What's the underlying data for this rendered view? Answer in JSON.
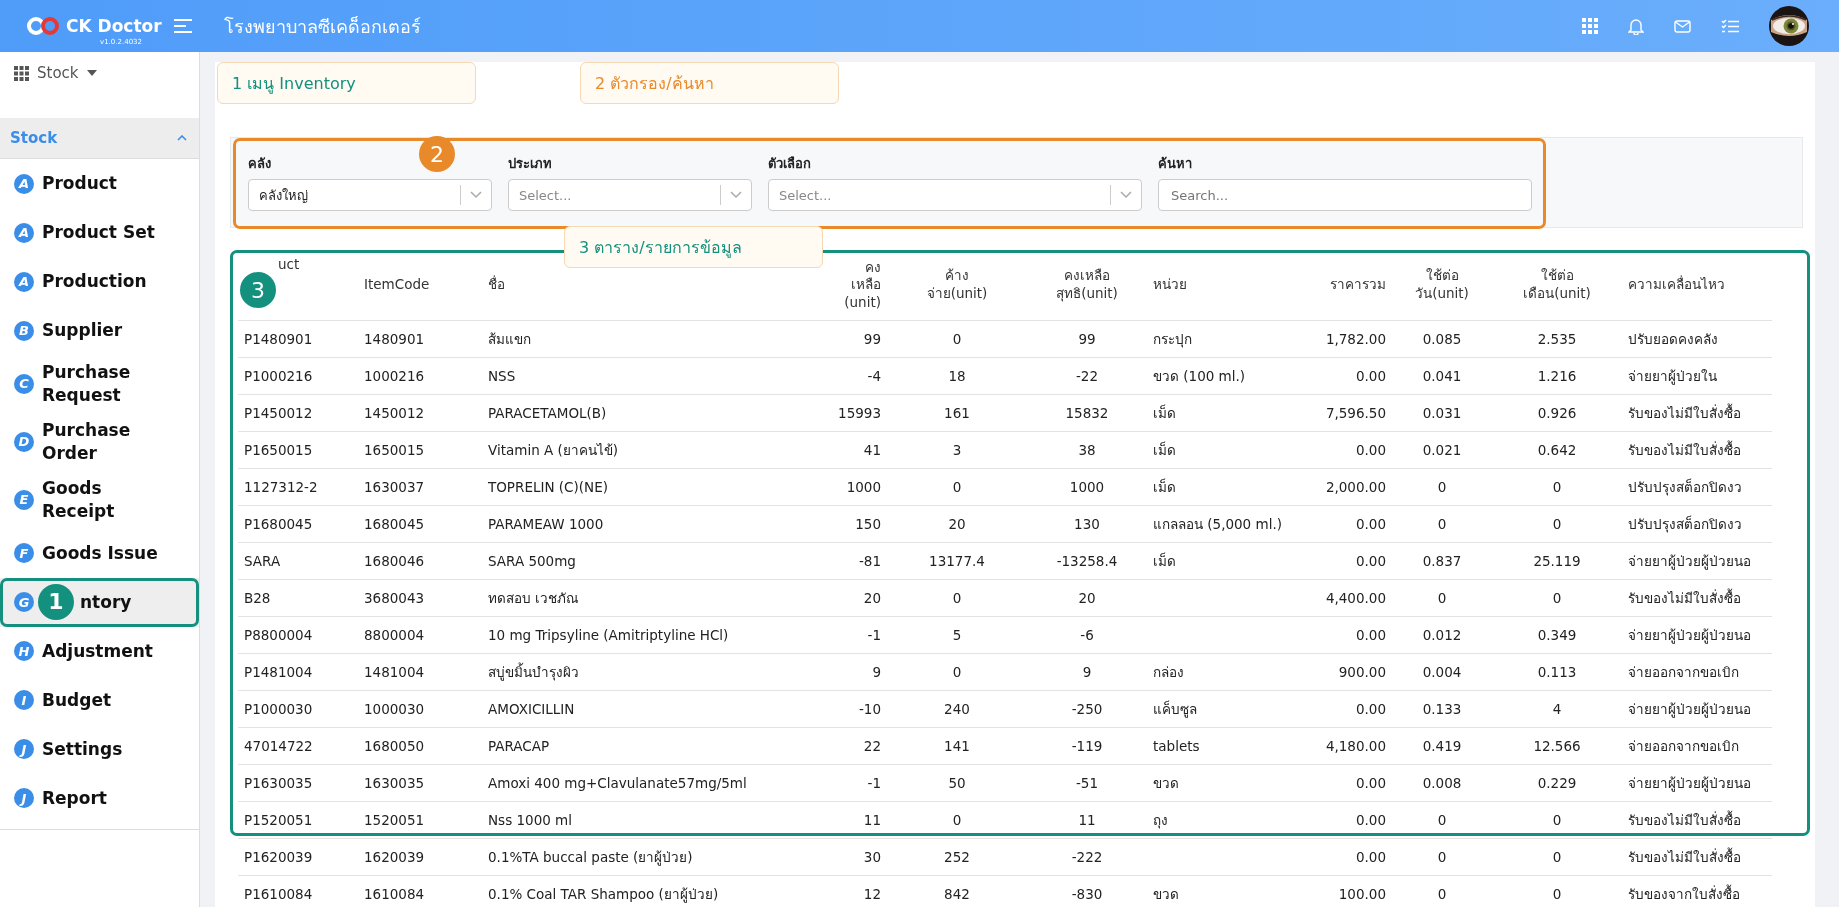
{
  "header": {
    "logo": "CK Doctor",
    "version": "v1.0.2.4032",
    "title": "โรงพยาบาลซีเคด็อกเตอร์"
  },
  "sidebar": {
    "module": "Stock",
    "section": {
      "label": "Stock",
      "expanded": true
    },
    "items": [
      {
        "letter": "A",
        "label": "Product",
        "selected": false
      },
      {
        "letter": "A",
        "label": "Product Set",
        "selected": false
      },
      {
        "letter": "A",
        "label": "Production",
        "selected": false
      },
      {
        "letter": "B",
        "label": "Supplier",
        "selected": false
      },
      {
        "letter": "C",
        "label": "Purchase Request",
        "selected": false
      },
      {
        "letter": "D",
        "label": "Purchase Order",
        "selected": false
      },
      {
        "letter": "E",
        "label": "Goods Receipt",
        "selected": false
      },
      {
        "letter": "F",
        "label": "Goods Issue",
        "selected": false
      },
      {
        "letter": "G",
        "label": "ntory",
        "selected": true,
        "marker": {
          "number": "1",
          "color": "#13907e"
        }
      },
      {
        "letter": "H",
        "label": "Adjustment",
        "selected": false
      },
      {
        "letter": "I",
        "label": "Budget",
        "selected": false
      },
      {
        "letter": "J",
        "label": "Settings",
        "selected": false
      },
      {
        "letter": "J",
        "label": "Report",
        "selected": false
      }
    ]
  },
  "callouts": [
    {
      "text": "1 เมนู Inventory",
      "color": "#13907e"
    },
    {
      "text": "2 ตัวกรอง/ค้นหา",
      "color": "#e8892a"
    },
    {
      "text": "3 ตาราง/รายการข้อมูล",
      "color": "#13907e"
    }
  ],
  "filters": {
    "marker": {
      "number": "2",
      "color": "#e8892a"
    },
    "fields": [
      {
        "kind": "select",
        "label": "คลัง",
        "value": "คลังใหญ่"
      },
      {
        "kind": "select",
        "label": "ประเภท",
        "placeholder": "Select..."
      },
      {
        "kind": "select",
        "label": "ตัวเลือก",
        "placeholder": "Select..."
      },
      {
        "kind": "search",
        "label": "ค้นหา",
        "placeholder": "Search..."
      }
    ]
  },
  "table": {
    "marker": {
      "number": "3",
      "color": "#13907e"
    },
    "columns": [
      "uct",
      "ItemCode",
      "ชื่อ",
      "คง\nเหลือ\n(unit)",
      "ค้าง\nจ่าย(unit)",
      "คงเหลือ\nสุทธิ(unit)",
      "หน่วย",
      "ราคารวม",
      "ใช้ต่อ\nวัน(unit)",
      "ใช้ต่อ\nเดือน(unit)",
      "ความเคลื่อนไหว"
    ],
    "rows": [
      {
        "product": "P1480901",
        "item_code": "1480901",
        "name": "ส้มแขก",
        "on_hand": "99",
        "pending": "0",
        "net": "99",
        "unit": "กระปุก",
        "total": "1,782.00",
        "per_day": "0.085",
        "per_month": "2.535",
        "movement": "ปรับยอดคงคลัง"
      },
      {
        "product": "P1000216",
        "item_code": "1000216",
        "name": "NSS",
        "on_hand": "-4",
        "pending": "18",
        "net": "-22",
        "unit": "ขวด (100 ml.)",
        "total": "0.00",
        "per_day": "0.041",
        "per_month": "1.216",
        "movement": "จ่ายยาผู้ป่วยใน"
      },
      {
        "product": "P1450012",
        "item_code": "1450012",
        "name": "PARACETAMOL(B)",
        "on_hand": "15993",
        "pending": "161",
        "net": "15832",
        "unit": "เม็ด",
        "total": "7,596.50",
        "per_day": "0.031",
        "per_month": "0.926",
        "movement": "รับของไม่มีใบสั่งซื้อ"
      },
      {
        "product": "P1650015",
        "item_code": "1650015",
        "name": "Vitamin A (ยาคนไข้)",
        "on_hand": "41",
        "pending": "3",
        "net": "38",
        "unit": "เม็ด",
        "total": "0.00",
        "per_day": "0.021",
        "per_month": "0.642",
        "movement": "รับของไม่มีใบสั่งซื้อ"
      },
      {
        "product": "1127312-2",
        "item_code": "1630037",
        "name": "TOPRELIN (C)(NE)",
        "on_hand": "1000",
        "pending": "0",
        "net": "1000",
        "unit": "เม็ด",
        "total": "2,000.00",
        "per_day": "0",
        "per_month": "0",
        "movement": "ปรับปรุงสต็อกปิดงว"
      },
      {
        "product": "P1680045",
        "item_code": "1680045",
        "name": "PARAMEAW 1000",
        "on_hand": "150",
        "pending": "20",
        "net": "130",
        "unit": "แกลลอน (5,000 ml.)",
        "total": "0.00",
        "per_day": "0",
        "per_month": "0",
        "movement": "ปรับปรุงสต็อกปิดงว"
      },
      {
        "product": "SARA",
        "item_code": "1680046",
        "name": "SARA 500mg",
        "on_hand": "-81",
        "pending": "13177.4",
        "net": "-13258.4",
        "unit": "เม็ด",
        "total": "0.00",
        "per_day": "0.837",
        "per_month": "25.119",
        "movement": "จ่ายยาผู้ป่วยผู้ป่วยนอ"
      },
      {
        "product": "B28",
        "item_code": "3680043",
        "name": "ทดสอบ เวชภัณ",
        "on_hand": "20",
        "pending": "0",
        "net": "20",
        "total": "4,400.00",
        "per_day": "0",
        "per_month": "0",
        "movement": "รับของไม่มีใบสั่งซื้อ"
      },
      {
        "product": "P8800004",
        "item_code": "8800004",
        "name": "10 mg Tripsyline (Amitriptyline HCl)",
        "on_hand": "-1",
        "pending": "5",
        "net": "-6",
        "total": "0.00",
        "per_day": "0.012",
        "per_month": "0.349",
        "movement": "จ่ายยาผู้ป่วยผู้ป่วยนอ"
      },
      {
        "product": "P1481004",
        "item_code": "1481004",
        "name": "สบู่ขมิ้นบำรุงผิว",
        "on_hand": "9",
        "pending": "0",
        "net": "9",
        "unit": "กล่อง",
        "total": "900.00",
        "per_day": "0.004",
        "per_month": "0.113",
        "movement": "จ่ายออกจากขอเบิก"
      },
      {
        "product": "P1000030",
        "item_code": "1000030",
        "name": "AMOXICILLIN",
        "on_hand": "-10",
        "pending": "240",
        "net": "-250",
        "unit": "แค็บซูล",
        "total": "0.00",
        "per_day": "0.133",
        "per_month": "4",
        "movement": "จ่ายยาผู้ป่วยผู้ป่วยนอ"
      },
      {
        "product": "47014722",
        "item_code": "1680050",
        "name": "PARACAP",
        "on_hand": "22",
        "pending": "141",
        "net": "-119",
        "unit": "tablets",
        "total": "4,180.00",
        "per_day": "0.419",
        "per_month": "12.566",
        "movement": "จ่ายออกจากขอเบิก"
      },
      {
        "product": "P1630035",
        "item_code": "1630035",
        "name": "Amoxi 400 mg+Clavulanate57mg/5ml",
        "on_hand": "-1",
        "pending": "50",
        "net": "-51",
        "unit": "ขวด",
        "total": "0.00",
        "per_day": "0.008",
        "per_month": "0.229",
        "movement": "จ่ายยาผู้ป่วยผู้ป่วยนอ"
      },
      {
        "product": "P1520051",
        "item_code": "1520051",
        "name": "Nss 1000 ml",
        "on_hand": "11",
        "pending": "0",
        "net": "11",
        "unit": "ถุง",
        "total": "0.00",
        "per_day": "0",
        "per_month": "0",
        "movement": "รับของไม่มีใบสั่งซื้อ"
      },
      {
        "product": "P1620039",
        "item_code": "1620039",
        "name": "0.1%TA buccal paste (ยาผู้ป่วย)",
        "on_hand": "30",
        "pending": "252",
        "net": "-222",
        "total": "0.00",
        "per_day": "0",
        "per_month": "0",
        "movement": "รับของไม่มีใบสั่งซื้อ"
      },
      {
        "product": "P1610084",
        "item_code": "1610084",
        "name": "0.1% Coal TAR Shampoo (ยาผู้ป่วย)",
        "on_hand": "12",
        "pending": "842",
        "net": "-830",
        "unit": "ขวด",
        "total": "100.00",
        "per_day": "0",
        "per_month": "0",
        "movement": "รับของจากใบสั่งซื้อ"
      }
    ]
  }
}
